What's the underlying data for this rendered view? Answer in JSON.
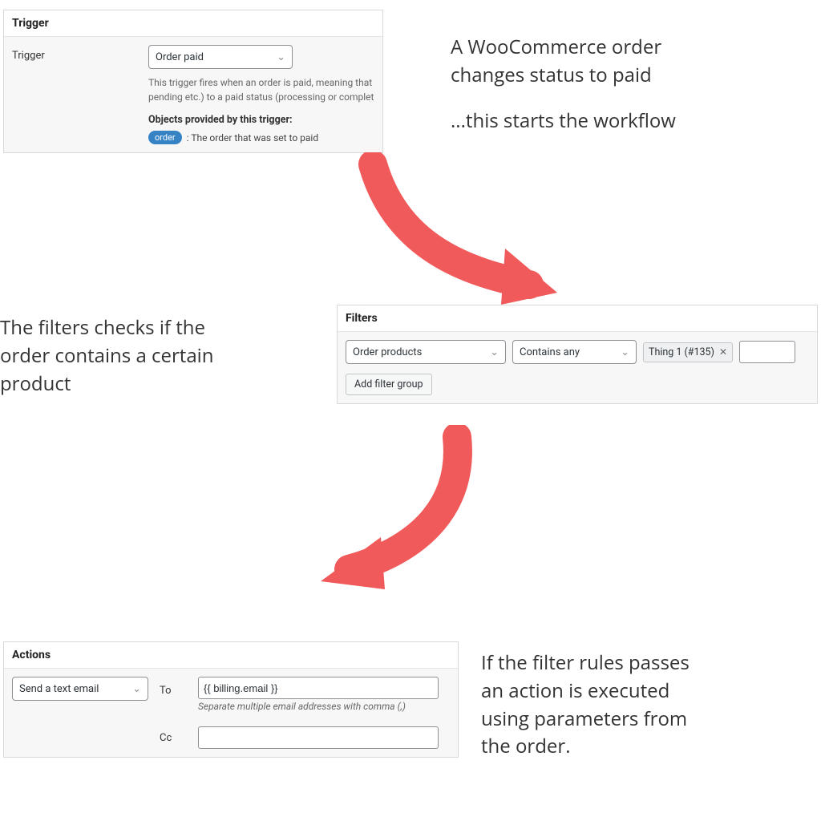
{
  "trigger_panel": {
    "title": "Trigger",
    "field_label": "Trigger",
    "select_value": "Order paid",
    "help_text": "This trigger fires when an order is paid, meaning that pending etc.) to a paid status (processing or complet",
    "objects_heading": "Objects provided by this trigger:",
    "object_pill": "order",
    "object_desc": ": The order that was set to paid"
  },
  "filters_panel": {
    "title": "Filters",
    "select_subject": "Order products",
    "select_op": "Contains any",
    "token": "Thing 1 (#135)",
    "add_group": "Add filter group"
  },
  "actions_panel": {
    "title": "Actions",
    "select_value": "Send a text email",
    "to_label": "To",
    "to_value": "{{ billing.email }}",
    "to_help": "Separate multiple email addresses with comma (,)",
    "cc_label": "Cc"
  },
  "annot": {
    "a1_line1": "A WooCommerce order",
    "a1_line2": "changes status to paid",
    "a1_line3": "...this starts the workflow",
    "a2_line1": "The filters checks if the",
    "a2_line2": "order contains a certain",
    "a2_line3": "product",
    "a3_line1": "If the filter rules passes",
    "a3_line2": "an action is executed",
    "a3_line3": "using parameters from",
    "a3_line4": "the order."
  }
}
